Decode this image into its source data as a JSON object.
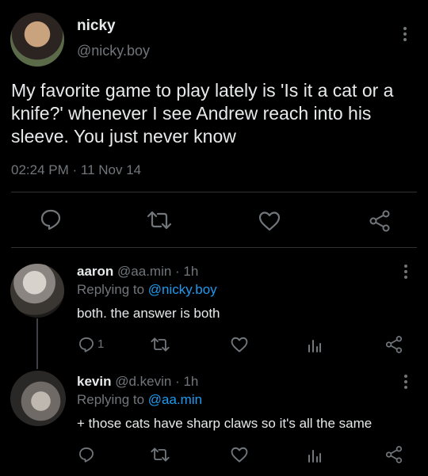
{
  "main_tweet": {
    "author_name": "nicky",
    "author_handle": "@nicky.boy",
    "text": "My favorite game to play lately is 'Is it a cat or a knife?' whenever I see Andrew reach into his sleeve. You just never know",
    "timestamp": "02:24 PM · 11 Nov 14"
  },
  "replies": [
    {
      "author_name": "aaron",
      "meta": "@aa.min · 1h",
      "replying_label": "Replying to",
      "replying_to": "@nicky.boy",
      "text": "both. the answer is both",
      "reply_count": "1"
    },
    {
      "author_name": "kevin",
      "meta": "@d.kevin · 1h",
      "replying_label": "Replying to",
      "replying_to": "@aa.min",
      "text": "+ those cats have sharp claws so it's all the same",
      "reply_count": ""
    }
  ],
  "colors": {
    "background": "#000000",
    "text": "#e7e9ea",
    "muted": "#71767b",
    "link": "#1d9bf0",
    "divider": "#2f3336"
  },
  "icons": [
    "comment-icon",
    "retweet-icon",
    "heart-icon",
    "share-icon",
    "analytics-icon",
    "more-icon"
  ]
}
